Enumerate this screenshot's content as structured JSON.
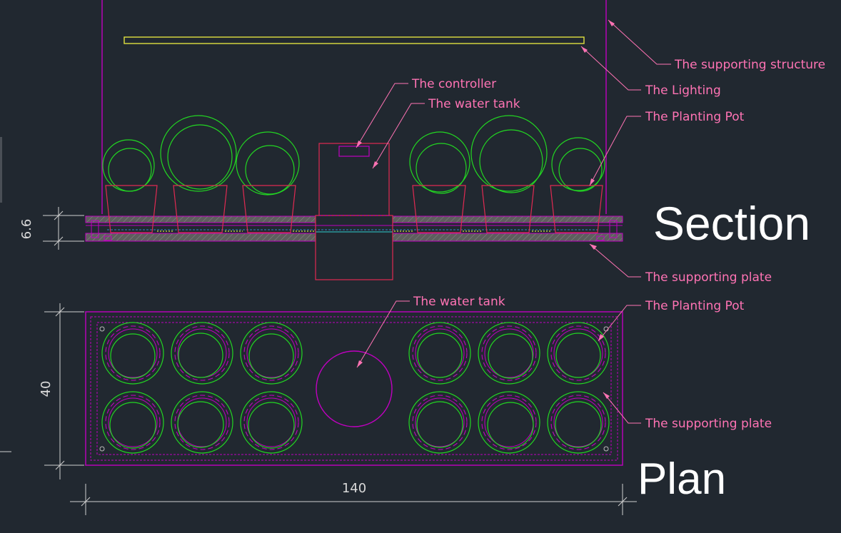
{
  "colors": {
    "background": "#212830",
    "structure": "#c000c0",
    "pot_green": "#22d622",
    "pot_red": "#e02a52",
    "lighting": "#e0e040",
    "plate_fill": "#6a6a6a",
    "leader": "#ff73b4",
    "dimension": "#cfcfcf",
    "title": "#ffffff"
  },
  "section": {
    "title": "Section",
    "labels": {
      "supporting_structure": "The supporting structure",
      "lighting": "The Lighting",
      "planting_pot": "The Planting Pot",
      "controller": "The controller",
      "water_tank": "The water tank",
      "supporting_plate": "The supporting plate"
    },
    "height_dimension": "6.6"
  },
  "plan": {
    "title": "Plan",
    "labels": {
      "water_tank": "The water tank",
      "planting_pot": "The Planting Pot",
      "supporting_plate": "The supporting plate"
    },
    "height_dimension": "40",
    "width_dimension": "140"
  }
}
